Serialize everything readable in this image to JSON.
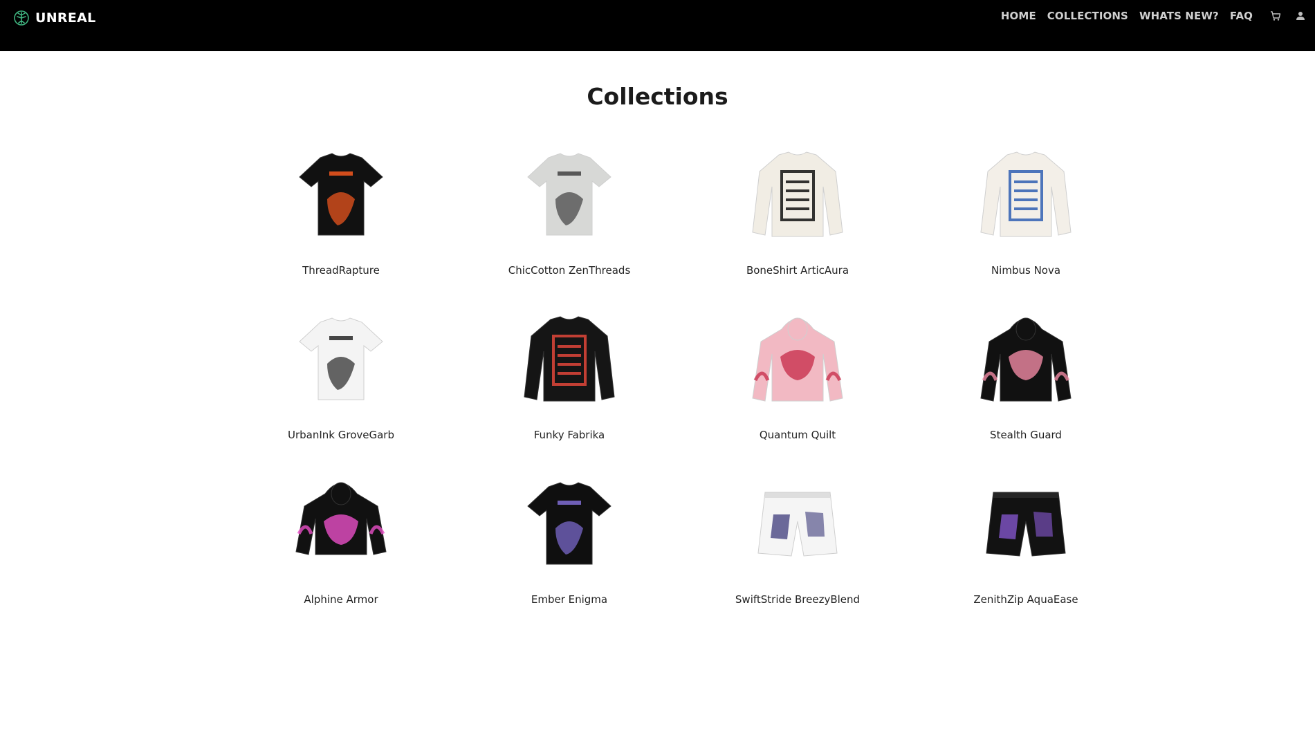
{
  "brand": {
    "name": "UNREAL",
    "logo_icon": "tree-emblem-icon",
    "accent": "#3fb37f"
  },
  "nav": {
    "items": [
      "HOME",
      "COLLECTIONS",
      "WHATS NEW?",
      "FAQ"
    ],
    "icons": [
      "cart-icon",
      "user-icon"
    ]
  },
  "page": {
    "title": "Collections"
  },
  "products": [
    {
      "name": "ThreadRapture",
      "garment": "tshirt",
      "base": "#111111",
      "accent": "#e8541e"
    },
    {
      "name": "ChicCotton ZenThreads",
      "garment": "tshirt",
      "base": "#d7d8d6",
      "accent": "#4a4a4a"
    },
    {
      "name": "BoneShirt ArticAura",
      "garment": "sweatshirt",
      "base": "#f1ede4",
      "accent": "#111111"
    },
    {
      "name": "Nimbus Nova",
      "garment": "sweatshirt",
      "base": "#f3efe8",
      "accent": "#2f5fb3"
    },
    {
      "name": "UrbanInk GroveGarb",
      "garment": "tshirt",
      "base": "#f4f4f4",
      "accent": "#333333"
    },
    {
      "name": "Funky Fabrika",
      "garment": "sweatshirt",
      "base": "#151515",
      "accent": "#e1463a"
    },
    {
      "name": "Quantum Quilt",
      "garment": "hoodie",
      "base": "#f2b9c3",
      "accent": "#c8324f"
    },
    {
      "name": "Stealth Guard",
      "garment": "hoodie",
      "base": "#111111",
      "accent": "#f08aa4"
    },
    {
      "name": "Alphine Armor",
      "garment": "hoodie-cropped",
      "base": "#111111",
      "accent": "#e94fc7"
    },
    {
      "name": "Ember Enigma",
      "garment": "tshirt",
      "base": "#0f0f0f",
      "accent": "#7a68c9"
    },
    {
      "name": "SwiftStride BreezyBlend",
      "garment": "shorts",
      "base": "#f5f5f5",
      "accent": "#3c3a7a"
    },
    {
      "name": "ZenithZip AquaEase",
      "garment": "shorts",
      "base": "#121212",
      "accent": "#8a5ad6"
    }
  ]
}
